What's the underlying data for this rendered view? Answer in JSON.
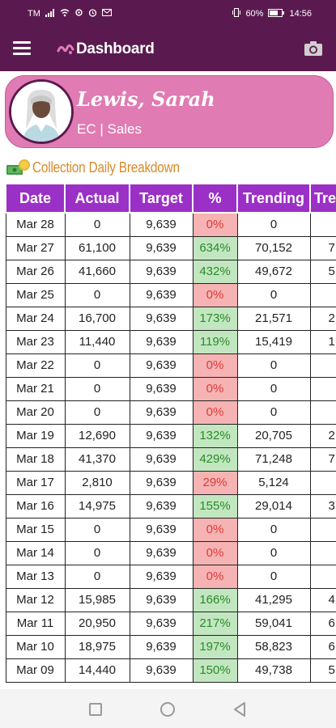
{
  "status_bar": {
    "carrier": "TM",
    "battery": "60%",
    "time": "14:56"
  },
  "app_bar": {
    "title": "Dashboard",
    "menu_icon": "hamburger-menu-icon",
    "camera_icon": "camera-icon"
  },
  "profile": {
    "name": "Lewis, Sarah",
    "subtitle": "EC | Sales"
  },
  "section": {
    "title": "Collection Daily Breakdown",
    "icon": "money-icon"
  },
  "table": {
    "headers": [
      "Date",
      "Actual",
      "Target",
      "%",
      "Trending",
      "Tre"
    ],
    "rows": [
      {
        "date": "Mar 28",
        "actual": "0",
        "target": "9,639",
        "pct": "0%",
        "status": "red",
        "trending": "0",
        "tre": ""
      },
      {
        "date": "Mar 27",
        "actual": "61,100",
        "target": "9,639",
        "pct": "634%",
        "status": "green",
        "trending": "70,152",
        "tre": "7"
      },
      {
        "date": "Mar 26",
        "actual": "41,660",
        "target": "9,639",
        "pct": "432%",
        "status": "green",
        "trending": "49,672",
        "tre": "5"
      },
      {
        "date": "Mar 25",
        "actual": "0",
        "target": "9,639",
        "pct": "0%",
        "status": "red",
        "trending": "0",
        "tre": ""
      },
      {
        "date": "Mar 24",
        "actual": "16,700",
        "target": "9,639",
        "pct": "173%",
        "status": "green",
        "trending": "21,571",
        "tre": "2"
      },
      {
        "date": "Mar 23",
        "actual": "11,440",
        "target": "9,639",
        "pct": "119%",
        "status": "green",
        "trending": "15,419",
        "tre": "1"
      },
      {
        "date": "Mar 22",
        "actual": "0",
        "target": "9,639",
        "pct": "0%",
        "status": "red",
        "trending": "0",
        "tre": ""
      },
      {
        "date": "Mar 21",
        "actual": "0",
        "target": "9,639",
        "pct": "0%",
        "status": "red",
        "trending": "0",
        "tre": ""
      },
      {
        "date": "Mar 20",
        "actual": "0",
        "target": "9,639",
        "pct": "0%",
        "status": "red",
        "trending": "0",
        "tre": ""
      },
      {
        "date": "Mar 19",
        "actual": "12,690",
        "target": "9,639",
        "pct": "132%",
        "status": "green",
        "trending": "20,705",
        "tre": "2"
      },
      {
        "date": "Mar 18",
        "actual": "41,370",
        "target": "9,639",
        "pct": "429%",
        "status": "green",
        "trending": "71,248",
        "tre": "7"
      },
      {
        "date": "Mar 17",
        "actual": "2,810",
        "target": "9,639",
        "pct": "29%",
        "status": "red",
        "trending": "5,124",
        "tre": ""
      },
      {
        "date": "Mar 16",
        "actual": "14,975",
        "target": "9,639",
        "pct": "155%",
        "status": "green",
        "trending": "29,014",
        "tre": "3"
      },
      {
        "date": "Mar 15",
        "actual": "0",
        "target": "9,639",
        "pct": "0%",
        "status": "red",
        "trending": "0",
        "tre": ""
      },
      {
        "date": "Mar 14",
        "actual": "0",
        "target": "9,639",
        "pct": "0%",
        "status": "red",
        "trending": "0",
        "tre": ""
      },
      {
        "date": "Mar 13",
        "actual": "0",
        "target": "9,639",
        "pct": "0%",
        "status": "red",
        "trending": "0",
        "tre": ""
      },
      {
        "date": "Mar 12",
        "actual": "15,985",
        "target": "9,639",
        "pct": "166%",
        "status": "green",
        "trending": "41,295",
        "tre": "4"
      },
      {
        "date": "Mar 11",
        "actual": "20,950",
        "target": "9,639",
        "pct": "217%",
        "status": "green",
        "trending": "59,041",
        "tre": "6"
      },
      {
        "date": "Mar 10",
        "actual": "18,975",
        "target": "9,639",
        "pct": "197%",
        "status": "green",
        "trending": "58,823",
        "tre": "6"
      },
      {
        "date": "Mar 09",
        "actual": "14,440",
        "target": "9,639",
        "pct": "150%",
        "status": "green",
        "trending": "49,738",
        "tre": "5"
      }
    ]
  },
  "colors": {
    "brand": "#5a1a4f",
    "header_purple": "#9b30c7",
    "profile_pink": "#e07bb3",
    "section_orange": "#d9892a",
    "pct_red_bg": "#f5b3b3",
    "pct_green_bg": "#c2e7c0"
  }
}
